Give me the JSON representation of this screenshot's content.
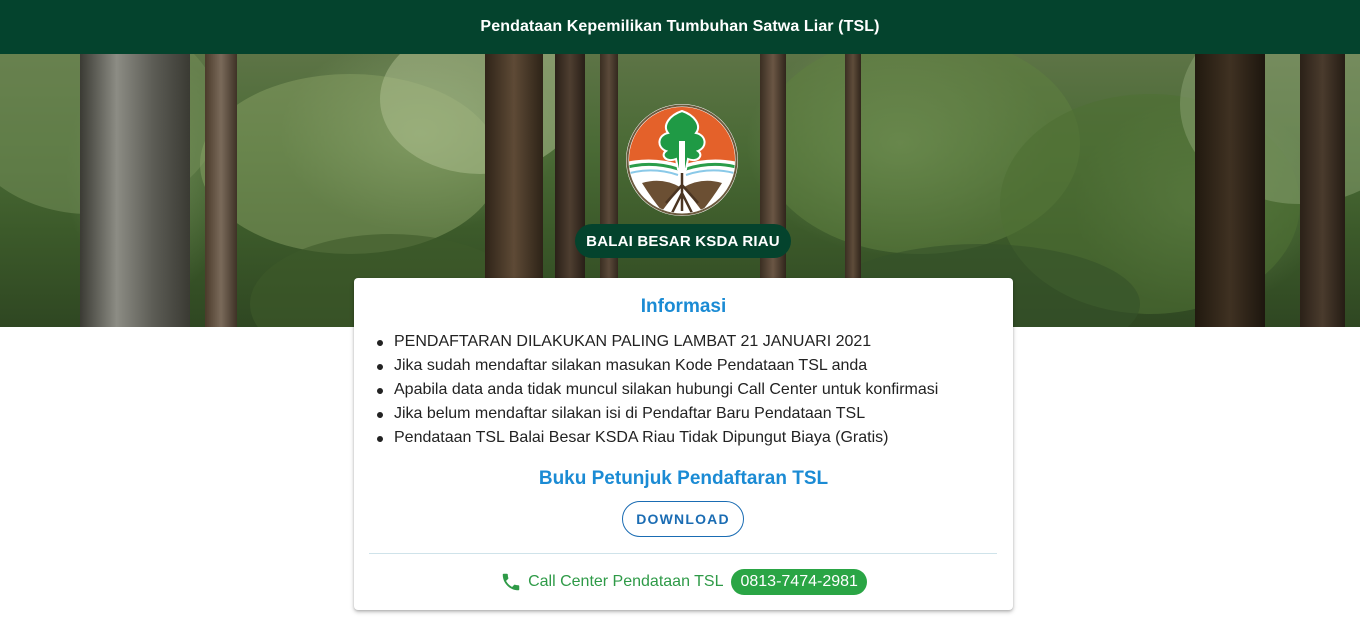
{
  "header": {
    "title": "Pendataan Kepemilikan Tumbuhan Satwa Liar (TSL)"
  },
  "hero": {
    "emblem_icon": "ministry-tree-emblem-icon",
    "org_name": "BALAI BESAR KSDA RIAU"
  },
  "info_card": {
    "title": "Informasi",
    "items": [
      "PENDAFTARAN DILAKUKAN PALING LAMBAT 21 JANUARI 2021",
      "Jika sudah mendaftar silakan masukan Kode Pendataan TSL anda",
      "Apabila data anda tidak muncul silakan hubungi Call Center untuk konfirmasi",
      "Jika belum mendaftar silakan isi di Pendaftar Baru Pendataan TSL",
      "Pendataan TSL Balai Besar KSDA Riau Tidak Dipungut Biaya (Gratis)"
    ],
    "guide_title": "Buku Petunjuk Pendaftaran TSL",
    "download_label": "DOWNLOAD",
    "call_center": {
      "icon": "phone-icon",
      "label": "Call Center Pendataan TSL",
      "number": "0813-7474-2981"
    }
  },
  "colors": {
    "header_bg": "#04432d",
    "accent_blue": "#1b8bd4",
    "button_blue": "#1a6cb3",
    "call_green": "#2aa545"
  }
}
